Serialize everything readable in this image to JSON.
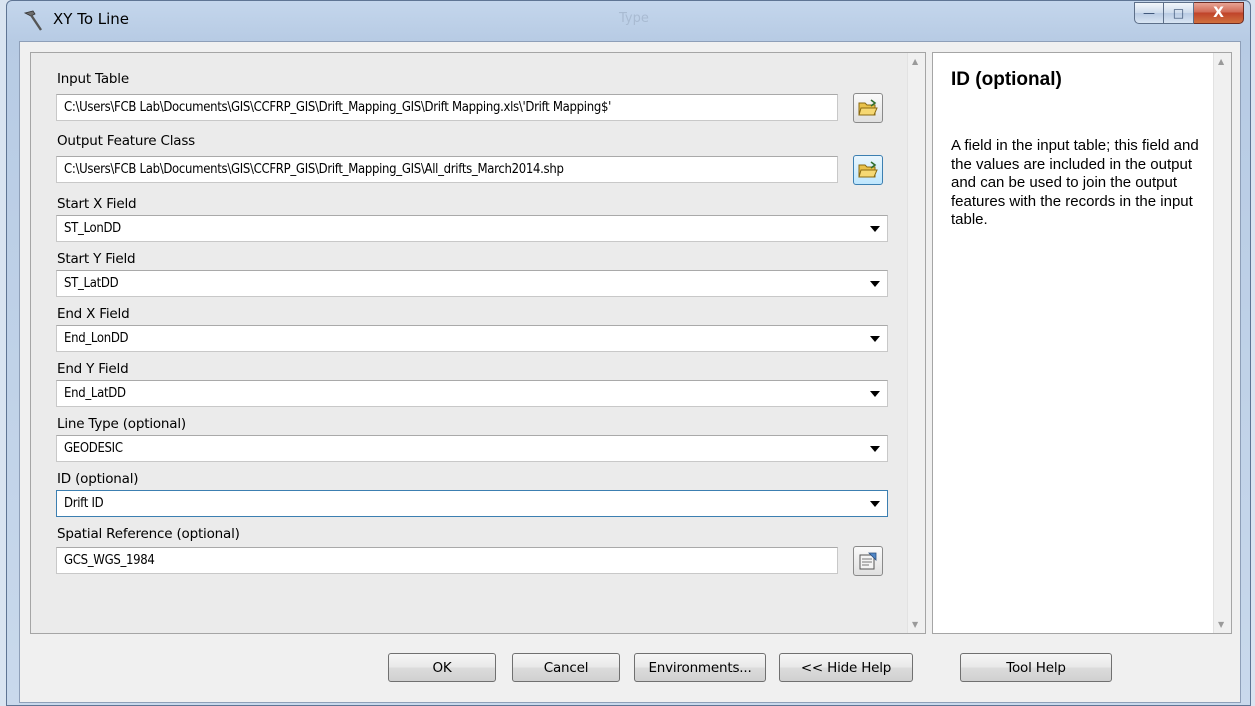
{
  "window": {
    "title": "XY To Line",
    "faded_caption": "Type",
    "minimize_glyph": "—",
    "maximize_glyph": "□",
    "close_glyph": "X"
  },
  "fields": {
    "input_table": {
      "label": "Input Table",
      "value": "C:\\Users\\FCB Lab\\Documents\\GIS\\CCFRP_GIS\\Drift_Mapping_GIS\\Drift Mapping.xls\\'Drift Mapping$'"
    },
    "output_feature_class": {
      "label": "Output Feature Class",
      "value": "C:\\Users\\FCB Lab\\Documents\\GIS\\CCFRP_GIS\\Drift_Mapping_GIS\\All_drifts_March2014.shp"
    },
    "start_x": {
      "label": "Start X Field",
      "value": "ST_LonDD"
    },
    "start_y": {
      "label": "Start Y Field",
      "value": "ST_LatDD"
    },
    "end_x": {
      "label": "End X Field",
      "value": "End_LonDD"
    },
    "end_y": {
      "label": "End Y Field",
      "value": "End_LatDD"
    },
    "line_type": {
      "label": "Line Type (optional)",
      "value": "GEODESIC"
    },
    "id": {
      "label": "ID (optional)",
      "value": "Drift ID"
    },
    "spatial_reference": {
      "label": "Spatial Reference (optional)",
      "value": "GCS_WGS_1984"
    }
  },
  "help": {
    "title": "ID (optional)",
    "body": "A field in the input table; this field and the values are included in the output and can be used to join the output features with the records in the input table."
  },
  "buttons": {
    "ok": "OK",
    "cancel": "Cancel",
    "environments": "Environments...",
    "hide_help": "<< Hide Help",
    "tool_help": "Tool Help"
  },
  "icons": {
    "title": "hammer-icon",
    "browse": "open-folder-icon",
    "spatial_reference": "properties-icon"
  },
  "colors": {
    "accent_blue": "#3c7fb1",
    "close_red": "#c0432a",
    "folder_yellow": "#e9c14a"
  }
}
